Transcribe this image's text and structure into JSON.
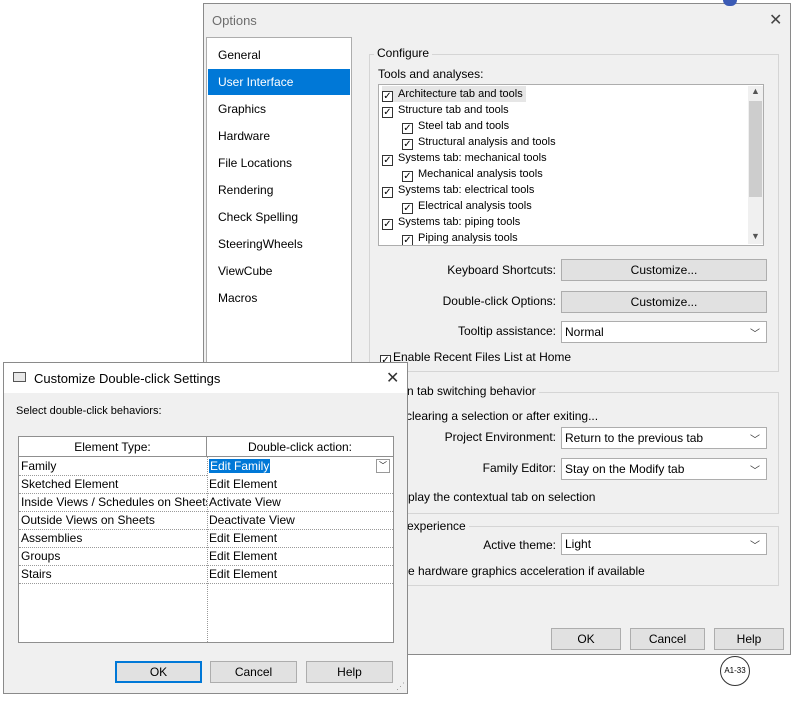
{
  "options": {
    "title": "Options",
    "nav": [
      "General",
      "User Interface",
      "Graphics",
      "Hardware",
      "File Locations",
      "Rendering",
      "Check Spelling",
      "SteeringWheels",
      "ViewCube",
      "Macros"
    ],
    "selected_nav": 1,
    "configure": {
      "label": "Configure",
      "tools_label": "Tools and analyses:",
      "tree": [
        {
          "label": "Architecture tab and tools",
          "indent": 0,
          "checked": true
        },
        {
          "label": "Structure tab and tools",
          "indent": 0,
          "checked": true
        },
        {
          "label": "Steel tab and tools",
          "indent": 1,
          "checked": true
        },
        {
          "label": "Structural analysis and tools",
          "indent": 1,
          "checked": true
        },
        {
          "label": "Systems tab: mechanical tools",
          "indent": 0,
          "checked": true
        },
        {
          "label": "Mechanical analysis tools",
          "indent": 1,
          "checked": true
        },
        {
          "label": "Systems tab: electrical tools",
          "indent": 0,
          "checked": true
        },
        {
          "label": "Electrical analysis tools",
          "indent": 1,
          "checked": true
        },
        {
          "label": "Systems tab: piping tools",
          "indent": 0,
          "checked": true
        },
        {
          "label": "Piping analysis tools",
          "indent": 1,
          "checked": true
        }
      ],
      "keyboard_label": "Keyboard Shortcuts:",
      "keyboard_btn": "Customize...",
      "dblclick_label": "Double-click Options:",
      "dblclick_btn": "Customize...",
      "tooltip_label": "Tooltip assistance:",
      "tooltip_value": "Normal",
      "recent_files": "Enable Recent Files List at Home",
      "recent_checked": true
    },
    "tab_switch": {
      "label": "n tab switching behavior",
      "subtitle": "clearing a selection or after exiting...",
      "project_label": "Project Environment:",
      "project_value": "Return to the previous tab",
      "family_label": "Family Editor:",
      "family_value": "Stay on the Modify tab",
      "contextual": "play the contextual tab on selection"
    },
    "experience": {
      "label": "experience",
      "theme_label": "Active theme:",
      "theme_value": "Light",
      "hw": "e hardware graphics acceleration if available"
    },
    "buttons": {
      "ok": "OK",
      "cancel": "Cancel",
      "help": "Help"
    }
  },
  "dblclick_dialog": {
    "title": "Customize Double-click Settings",
    "prompt": "Select double-click behaviors:",
    "col_element": "Element Type:",
    "col_action": "Double-click action:",
    "rows": [
      {
        "element": "Family",
        "action": "Edit Family"
      },
      {
        "element": "Sketched Element",
        "action": "Edit Element"
      },
      {
        "element": "Inside Views / Schedules on Sheets",
        "action": "Activate View"
      },
      {
        "element": "Outside Views on Sheets",
        "action": "Deactivate View"
      },
      {
        "element": "Assemblies",
        "action": "Edit Element"
      },
      {
        "element": "Groups",
        "action": "Edit Element"
      },
      {
        "element": "Stairs",
        "action": "Edit Element"
      }
    ],
    "buttons": {
      "ok": "OK",
      "cancel": "Cancel",
      "help": "Help"
    }
  },
  "marker": "A1-33",
  "accent": "#0078d7"
}
